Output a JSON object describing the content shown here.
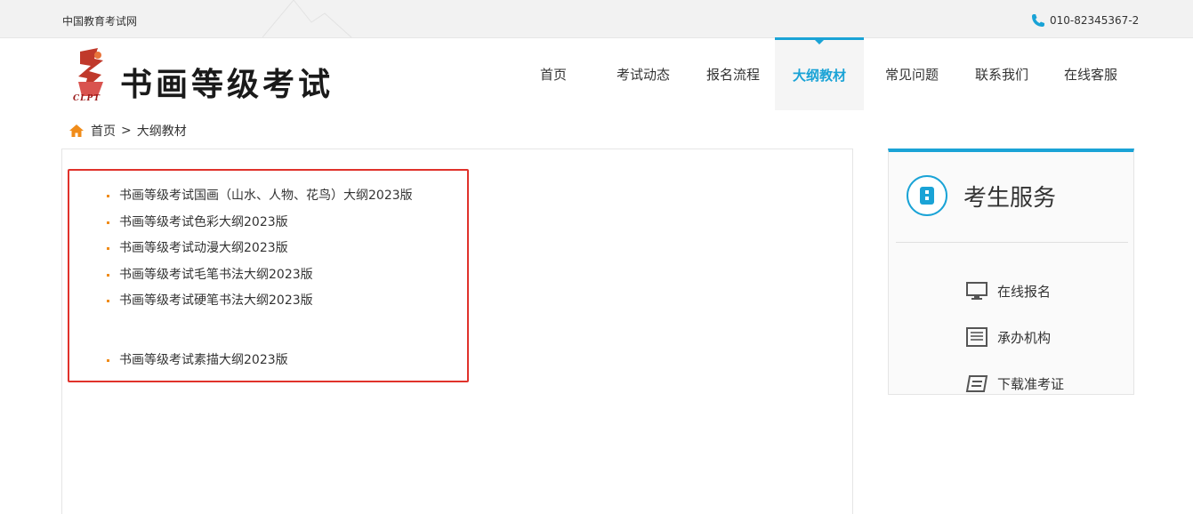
{
  "topbar": {
    "site_link": "中国教育考试网",
    "phone": "010-82345367-2"
  },
  "logo": {
    "title": "书画等级考试",
    "caption": "CLPT"
  },
  "nav": {
    "items": [
      {
        "label": "首页"
      },
      {
        "label": "考试动态"
      },
      {
        "label": "报名流程"
      },
      {
        "label": "大纲教材",
        "active": true
      },
      {
        "label": "常见问题"
      },
      {
        "label": "联系我们"
      },
      {
        "label": "在线客服"
      }
    ]
  },
  "breadcrumb": {
    "home": "首页",
    "separator": ">",
    "current": "大纲教材"
  },
  "outlines": [
    "书画等级考试国画（山水、人物、花鸟）大纲2023版",
    "书画等级考试色彩大纲2023版",
    "书画等级考试动漫大纲2023版",
    "书画等级考试毛笔书法大纲2023版",
    "书画等级考试硬笔书法大纲2023版",
    "书画等级考试素描大纲2023版"
  ],
  "sidebar": {
    "title": "考生服务",
    "items": [
      {
        "label": "在线报名",
        "icon": "monitor-icon"
      },
      {
        "label": "承办机构",
        "icon": "building-icon"
      },
      {
        "label": "下载准考证",
        "icon": "document-icon"
      }
    ]
  },
  "colors": {
    "accent": "#1aa3d6",
    "highlight_border": "#e0322b",
    "bullet": "#f08c1a",
    "home_icon": "#f08c1a",
    "phone_icon": "#1aa3d6",
    "logo_red": "#c0392b"
  }
}
